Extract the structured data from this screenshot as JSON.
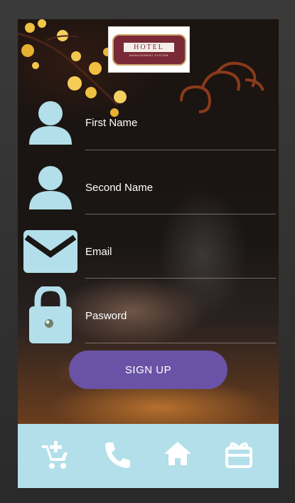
{
  "logo": {
    "title": "HOTEL",
    "subtitle": "MANAGEMENT SYSTEM"
  },
  "form": {
    "first_name": {
      "placeholder": "First Name",
      "icon": "person-icon"
    },
    "second_name": {
      "placeholder": "Second Name",
      "icon": "person-icon"
    },
    "email": {
      "placeholder": "Email",
      "icon": "mail-icon"
    },
    "password": {
      "placeholder": "Pasword",
      "icon": "lock-icon"
    },
    "signup_label": "SIGN UP"
  },
  "bottom_nav": [
    {
      "name": "add-to-cart",
      "icon": "add-cart-icon"
    },
    {
      "name": "call",
      "icon": "phone-icon"
    },
    {
      "name": "home",
      "icon": "home-icon"
    },
    {
      "name": "gift",
      "icon": "gift-card-icon"
    }
  ],
  "colors": {
    "accent": "#6a53a6",
    "icon_light_blue": "#b2dfea",
    "bottom_bar": "#b2dfea"
  }
}
